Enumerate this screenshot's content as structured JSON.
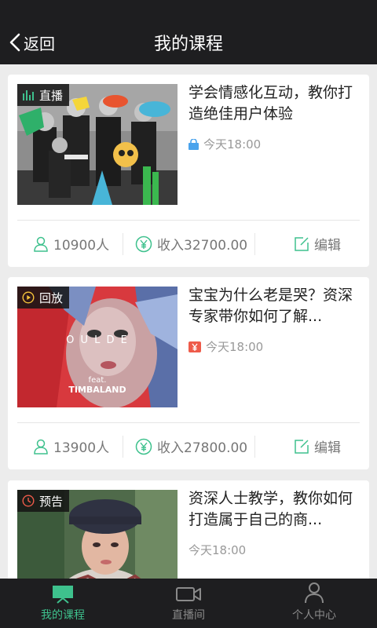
{
  "header": {
    "back_label": "返回",
    "title": "我的课程"
  },
  "courses": [
    {
      "badge": "直播",
      "badge_icon": "live-bars-icon",
      "title": "学会情感化互动，教你打造绝佳用户体验",
      "time": "今天18:00",
      "time_icon": "lock-icon",
      "students": "10900人",
      "income": "收入32700.00",
      "edit_label": "编辑"
    },
    {
      "badge": "回放",
      "badge_icon": "play-circle-icon",
      "title": "宝宝为什么老是哭？资深专家带你如何了解...",
      "time": "今天18:00",
      "time_icon": "yuan-tag-icon",
      "students": "13900人",
      "income": "收入27800.00",
      "edit_label": "编辑",
      "thumb_text": "O U L D E",
      "thumb_feat": "feat.",
      "thumb_artist": "TIMBALAND"
    },
    {
      "badge": "预告",
      "badge_icon": "clock-icon",
      "title": "资深人士教学，教你如何打造属于自己的商...",
      "time": "今天18:00"
    }
  ],
  "tabs": [
    {
      "label": "我的课程",
      "icon": "screen-icon",
      "active": true
    },
    {
      "label": "直播间",
      "icon": "video-camera-icon",
      "active": false
    },
    {
      "label": "个人中心",
      "icon": "user-icon",
      "active": false
    }
  ],
  "colors": {
    "accent": "#3ec18d",
    "topbar": "#1e1e20",
    "background": "#ececec",
    "lock_blue": "#4aa3ec",
    "tag_red": "#ee5b4a"
  }
}
